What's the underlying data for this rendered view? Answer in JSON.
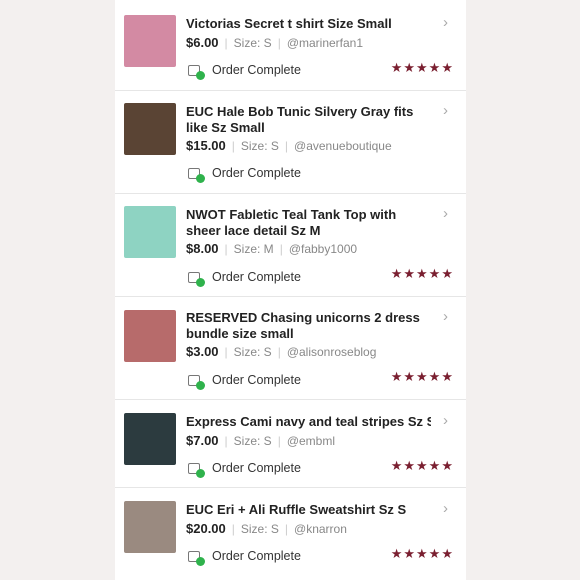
{
  "accent": "#7a1f30",
  "status_color": "#2fb24c",
  "items": [
    {
      "title": "Victorias Secret t shirt Size Small",
      "price": "$6.00",
      "size": "Size: S",
      "seller": "@marinerfan1",
      "status": "Order Complete",
      "rating": "★★★★★",
      "thumb_color": "#d38aa3"
    },
    {
      "title": "EUC Hale Bob Tunic Silvery Gray fits like Sz Small",
      "price": "$15.00",
      "size": "Size: S",
      "seller": "@avenueboutique",
      "status": "Order Complete",
      "rating": "",
      "thumb_color": "#5a4434"
    },
    {
      "title": "NWOT Fabletic Teal Tank Top with sheer lace detail Sz M",
      "price": "$8.00",
      "size": "Size: M",
      "seller": "@fabby1000",
      "status": "Order Complete",
      "rating": "★★★★★",
      "thumb_color": "#8ed3c2"
    },
    {
      "title": "RESERVED Chasing unicorns 2 dress bundle size small",
      "price": "$3.00",
      "size": "Size: S",
      "seller": "@alisonroseblog",
      "status": "Order Complete",
      "rating": "★★★★★",
      "thumb_color": "#b76b6b"
    },
    {
      "title": "Express Cami navy and teal stripes Sz S...",
      "price": "$7.00",
      "size": "Size: S",
      "seller": "@embml",
      "status": "Order Complete",
      "rating": "★★★★★",
      "thumb_color": "#2c3b3f"
    },
    {
      "title": "EUC Eri + Ali Ruffle Sweatshirt Sz S",
      "price": "$20.00",
      "size": "Size: S",
      "seller": "@knarron",
      "status": "Order Complete",
      "rating": "★★★★★",
      "thumb_color": "#9a8a80"
    }
  ]
}
